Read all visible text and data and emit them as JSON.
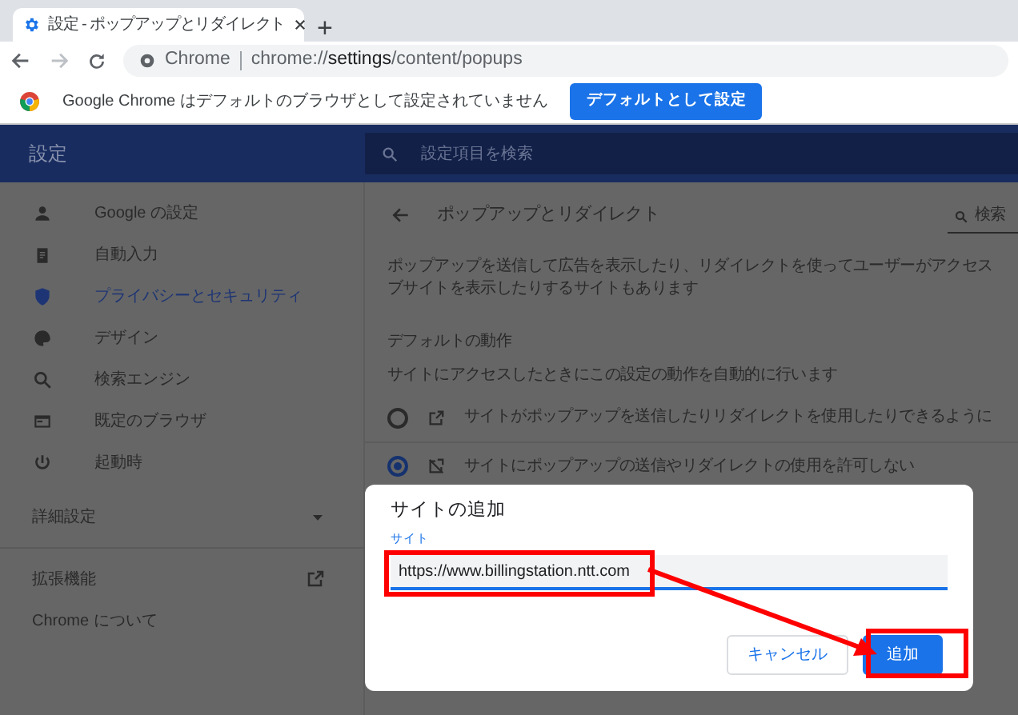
{
  "tabs": [
    {
      "title": "設定 - ポップアップとリダイレクト",
      "selected": true
    }
  ],
  "new_tab": "+",
  "address_bar": {
    "site_label": "Chrome",
    "url": "chrome://**settings**/content/popups"
  },
  "infobar": {
    "message": "Google Chrome はデフォルトのブラウザとして設定されていません",
    "button": "デフォルトとして設定"
  },
  "settings_header": {
    "title": "設定",
    "search_placeholder": "設定項目を検索"
  },
  "sidebar": {
    "items": [
      {
        "label": "Google の設定",
        "selected": false
      },
      {
        "label": "自動入力",
        "selected": false
      },
      {
        "label": "プライバシーとセキュリティ",
        "selected": true
      },
      {
        "label": "デザイン",
        "selected": false
      },
      {
        "label": "検索エンジン",
        "selected": false
      },
      {
        "label": "既定のブラウザ",
        "selected": false
      },
      {
        "label": "起動時",
        "selected": false
      }
    ],
    "advanced": {
      "label": "詳細設定",
      "expanded": false
    },
    "extensions": "拡張機能",
    "about": "Chrome について"
  },
  "content": {
    "title": "ポップアップとリダイレクト",
    "search": "検索",
    "description": [
      "ポップアップを送信して広告を表示したり、リダイレクトを使ってユーザーがアクセス",
      "ブサイトを表示したりするサイトもあります"
    ],
    "section_heading": "デフォルトの動作",
    "section_sub": "サイトにアクセスしたときにこの設定の動作を自動的に行います",
    "options": [
      {
        "label": "サイトがポップアップを送信したりリダイレクトを使用したりできるように",
        "selected": false
      },
      {
        "label": "サイトにポップアップの送信やリダイレクトの使用を許可しない",
        "selected": true
      }
    ]
  },
  "dialog": {
    "title": "サイトの追加",
    "field_label": "サイト",
    "field_value": "https://www.billingstation.ntt.com",
    "buttons": [
      {
        "label": "キャンセル",
        "kind": "secondary"
      },
      {
        "label": "追加",
        "kind": "primary"
      }
    ]
  }
}
